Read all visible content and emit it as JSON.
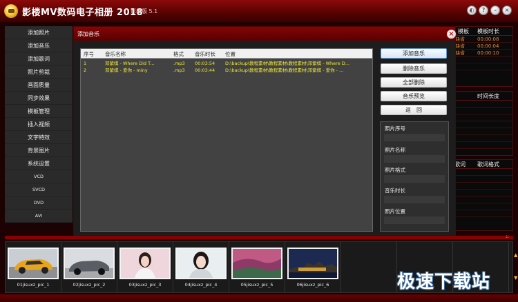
{
  "app": {
    "title": "影楼MV数码电子相册 2018",
    "edition": "影楼版 5.1"
  },
  "window_buttons": [
    "●",
    "●",
    "●",
    "●"
  ],
  "menu": {
    "items": [
      "添加照片",
      "添加音乐",
      "添加歌词",
      "照片剪裁",
      "画面质量",
      "同步效果",
      "模板管理",
      "插入视频",
      "文字特效",
      "背景图片",
      "系统设置",
      "VCD",
      "SVCD",
      "DVD",
      "AVI"
    ]
  },
  "bg_panel1": {
    "headers": [
      "模板",
      "模板时长"
    ],
    "rows": [
      [
        "缺省",
        "00:00:08"
      ],
      [
        "缺省",
        "00:00:04"
      ],
      [
        "缺省",
        "00:00:10"
      ]
    ]
  },
  "bg_panel2": {
    "headers": [
      "",
      "时间长度"
    ]
  },
  "bg_panel3": {
    "headers": [
      "歌词",
      "歌词格式"
    ]
  },
  "dialog": {
    "title": "添加音乐",
    "close": "×",
    "table": {
      "headers": [
        "序号",
        "音乐名称",
        "格式",
        "音乐时长",
        "位置"
      ],
      "rows": [
        [
          "1",
          "邓紫棋 - Where Did T...",
          ".mp3",
          "00:03:54",
          "D:\\backup\\教程素材\\教程素材\\教程素材\\邓紫棋 - Where D..."
        ],
        [
          "2",
          "邓紫棋 - 爱你 - miny",
          ".mp3",
          "00:03:44",
          "D:\\backup\\教程素材\\教程素材\\教程素材\\邓紫棋 - 爱你 - ..."
        ]
      ]
    },
    "buttons": {
      "add": "添加音乐",
      "delete": "删除音乐",
      "delete_all": "全部删除",
      "preview": "音乐预览",
      "back": "返　回"
    },
    "info": {
      "photo_index": "照片序号",
      "photo_name": "照片名称",
      "photo_format": "照片格式",
      "music_duration": "音乐时长",
      "photo_location": "照片位置"
    }
  },
  "filmstrip": {
    "thumbs": [
      "01jisuxz_pic_1",
      "02jisuxz_pic_2",
      "03jisuxz_pic_3",
      "04jisuxz_pic_4",
      "05jisuxz_pic_5",
      "06jisuxz_pic_6"
    ],
    "scroll_up": "▲",
    "scroll_down": "▼",
    "grid_icon": "::"
  },
  "watermark": "极速下载站"
}
